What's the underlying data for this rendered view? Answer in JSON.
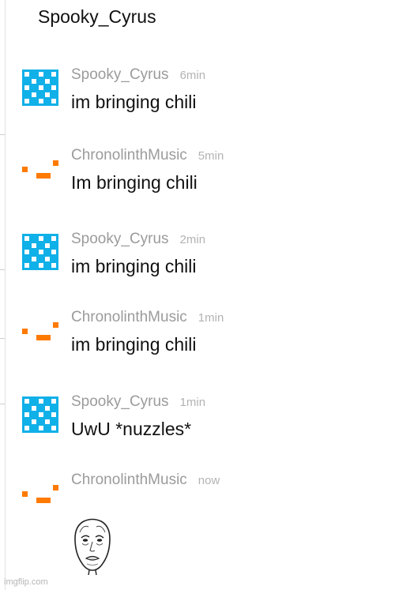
{
  "header": {
    "title": "Spooky_Cyrus"
  },
  "messages": [
    {
      "user": "Spooky_Cyrus",
      "time": "6min",
      "text": "im bringing chili",
      "avatar": "blue-checker-avatar"
    },
    {
      "user": "ChronolinthMusic",
      "time": "5min",
      "text": "Im bringing chili",
      "avatar": "orange-blocks-avatar"
    },
    {
      "user": "Spooky_Cyrus",
      "time": "2min",
      "text": "im bringing chili",
      "avatar": "blue-checker-avatar"
    },
    {
      "user": "ChronolinthMusic",
      "time": "1min",
      "text": "im bringing chili",
      "avatar": "orange-blocks-avatar"
    },
    {
      "user": "Spooky_Cyrus",
      "time": "1min",
      "text": "UwU *nuzzles*",
      "avatar": "blue-checker-avatar"
    },
    {
      "user": "ChronolinthMusic",
      "time": "now",
      "text": "",
      "avatar": "orange-blocks-avatar",
      "attachment": "okay-face-meme"
    }
  ],
  "colors": {
    "blue_avatar": "#10b0e8",
    "orange_avatar": "#ff7a00",
    "username": "#9b9b9b",
    "time": "#b3b3b3"
  },
  "watermark": "imgflip.com"
}
